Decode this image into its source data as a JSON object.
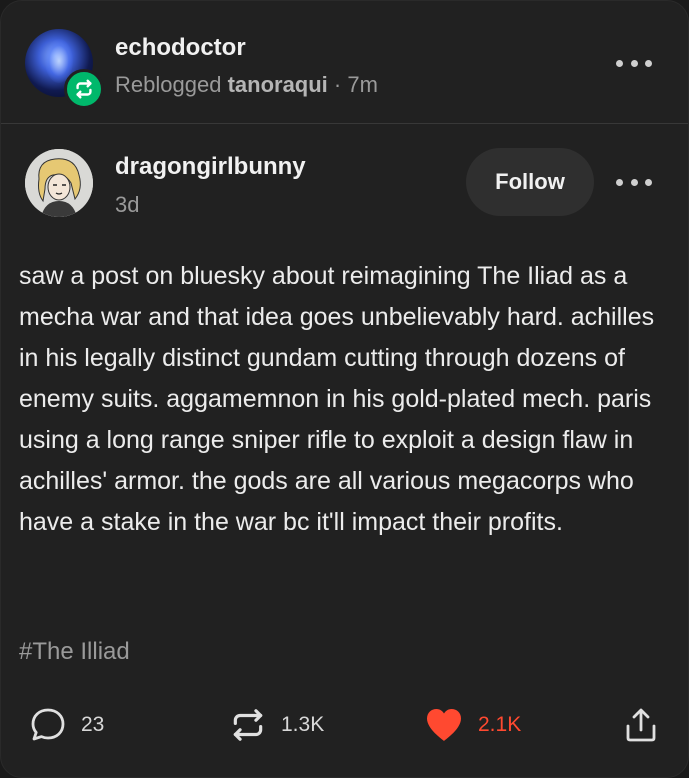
{
  "reblog": {
    "reblogger": "echodoctor",
    "prefix": "Reblogged",
    "source": "tanoraqui",
    "separator": "·",
    "time": "7m"
  },
  "post": {
    "author": "dragongirlbunny",
    "time": "3d",
    "follow_label": "Follow",
    "body": "saw a post on bluesky about reimagining The Iliad as a mecha war and that idea goes unbelievably hard. achilles in his legally distinct gundam cutting through dozens of enemy suits. aggamemnon in his gold-plated mech. paris using a long range sniper rifle to exploit a design flaw in achilles' armor. the gods are all various megacorps who have a stake in the war bc it'll impact their profits.",
    "tag": "#The Illiad"
  },
  "footer": {
    "comments": "23",
    "reblogs": "1.3K",
    "likes": "2.1K"
  },
  "colors": {
    "background": "#212121",
    "reblog_green": "#00b86b",
    "like_red": "#ff4930"
  },
  "icons": [
    "reblog-icon",
    "more-icon",
    "comment-icon",
    "reblog-count-icon",
    "heart-icon",
    "share-icon"
  ]
}
